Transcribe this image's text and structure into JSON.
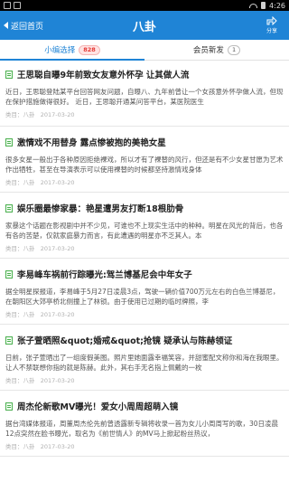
{
  "header": {
    "back_label": "返回首页",
    "title": "八卦",
    "share_label": "分享"
  },
  "statusbar": {
    "time": "4:26"
  },
  "tabs": [
    {
      "label": "小编选择",
      "badge": "828"
    },
    {
      "label": "会员新发",
      "badge": "1"
    }
  ],
  "articles": [
    {
      "title": "王思聪自曝9年前致女友意外怀孕 让其做人流",
      "body": "近日，王思聪登陆某平台回答网友问题，自曝八、九年前曾让一个女孩意外怀孕做人流，但现在保护措施做得很好。 近日，王思聪开通某问答平台，某医院医生",
      "category": "类目：八卦",
      "date": "2017-03-20"
    },
    {
      "title": "激情戏不用替身 露点惨被抱的美艳女星",
      "body": "很多女星一般出于各种原因拒绝裸戏，所以才有了裸替的风行，但还是有不少女星甘愿为艺术作出牺牲，甚至在导演表示可以使用裸替的时候都坚持激情戏身体",
      "category": "类目：八卦",
      "date": "2017-03-20"
    },
    {
      "title": "娱乐圈最惨家暴：艳星遭男友打断18根肋骨",
      "body": "家暴这个话题在影视剧中并不少见，可谁也不上现实生活中的种种。明星在风光的背后，也各有各的苦楚，仅就家庭暴力而言，有此遭遇的明星亦不乏其人。本",
      "category": "类目：八卦",
      "date": "2017-03-20"
    },
    {
      "title": "李易峰车祸前行踪曝光:驾兰博基尼会中年女子",
      "body": "据全明星探报道，李易峰于5月27日凌晨3点，驾驶一辆价值700万元左右的白色兰博基尼，在朝阳区大郊亭桥北侧撞上了林锁。由于使用已过期的临时牌照，李",
      "category": "类目：八卦",
      "date": "2017-03-20"
    },
    {
      "title": "张子萱晒照&quot;婚戒&quot;抢镜 疑承认与陈赫领证",
      "body": "日前，张子萱晒出了一组度假美图。照片里她面露幸福笑容，并甜蜜配文称你和海在我眼里。让人不禁联想你指的就是陈赫。此外，其右手无名指上佩戴的一枚",
      "category": "类目：八卦",
      "date": "2017-03-20"
    },
    {
      "title": "周杰伦新歌MV曝光！爱女小周周超萌入镜",
      "body": "据台湾媒体报道，周董周杰伦先前曾透露新专辑将收录一首为女儿小周周写的歌，30日凌晨12点突然在脸书曝光，取名为《前世情人》的MV马上掀起粉丝热议，",
      "category": "类目：八卦",
      "date": "2017-03-20"
    }
  ],
  "colors": {
    "accent": "#1f84d6",
    "badge_red": "#e53935"
  }
}
